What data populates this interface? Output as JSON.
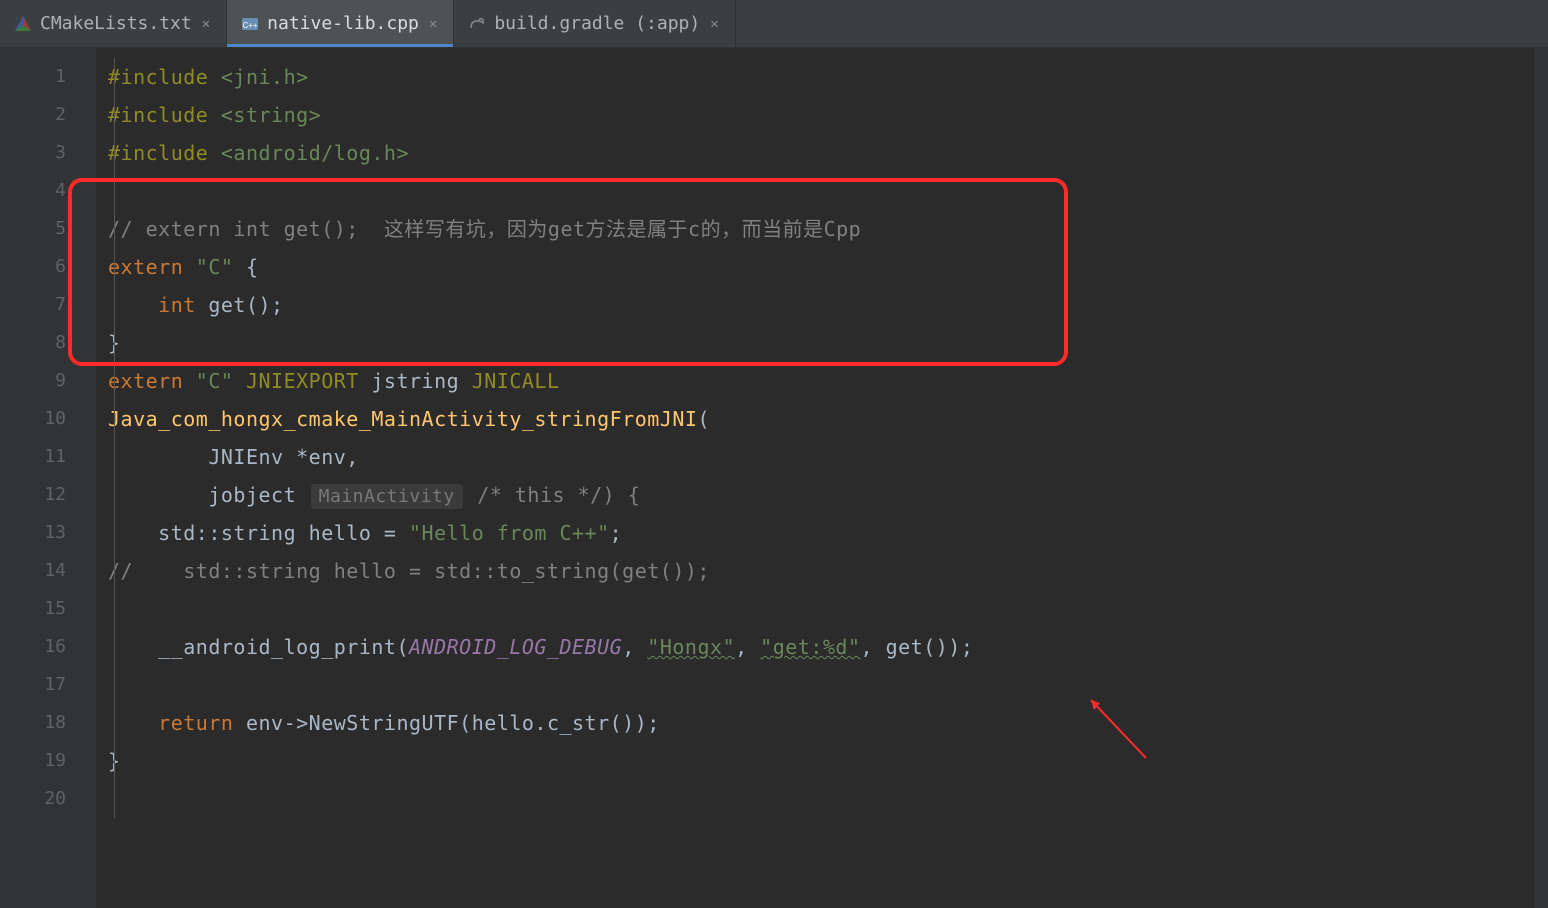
{
  "tabs": [
    {
      "label": "CMakeLists.txt",
      "active": false,
      "icon": "cmake"
    },
    {
      "label": "native-lib.cpp",
      "active": true,
      "icon": "cpp"
    },
    {
      "label": "build.gradle (:app)",
      "active": false,
      "icon": "gradle"
    }
  ],
  "gutter": {
    "lines": [
      "1",
      "2",
      "3",
      "4",
      "5",
      "6",
      "7",
      "8",
      "9",
      "10",
      "11",
      "12",
      "13",
      "14",
      "15",
      "16",
      "17",
      "18",
      "19",
      "20"
    ]
  },
  "code": {
    "l1": {
      "pre": "#include ",
      "inc": "<jni.h>"
    },
    "l2": {
      "pre": "#include ",
      "inc": "<string>"
    },
    "l3": {
      "pre": "#include ",
      "inc": "<android/log.h>"
    },
    "l5_cmt": "// extern int get();  这样写有坑，因为get方法是属于c的，而当前是Cpp",
    "l6": {
      "kw": "extern ",
      "str": "\"C\" ",
      "brace": "{"
    },
    "l7": {
      "kw": "int ",
      "fn": "get",
      "rest": "();"
    },
    "l8": "}",
    "l9": {
      "kw": "extern ",
      "str": "\"C\" ",
      "m1": "JNIEXPORT ",
      "t": "jstring ",
      "m2": "JNICALL"
    },
    "l10": {
      "fn": "Java_com_hongx_cmake_MainActivity_stringFromJNI",
      "rest": "("
    },
    "l11": "        JNIEnv *env,",
    "l12": {
      "pre": "        jobject ",
      "hint": "MainActivity",
      "post": " /* this */) {"
    },
    "l13": {
      "pre": "    std::string hello = ",
      "str": "\"Hello from C++\"",
      "post": ";"
    },
    "l14_cmt": "//    std::string hello = std::to_string(get());",
    "l16": {
      "pre": "    __android_log_print(",
      "m": "ANDROID_LOG_DEBUG",
      "c1": ", ",
      "s1": "\"Hongx\"",
      "c2": ", ",
      "s2": "\"get:%d\"",
      "post": ", get());"
    },
    "l18": {
      "kw": "    return ",
      "rest": "env->NewStringUTF(hello.c_str());"
    },
    "l19": "}"
  }
}
